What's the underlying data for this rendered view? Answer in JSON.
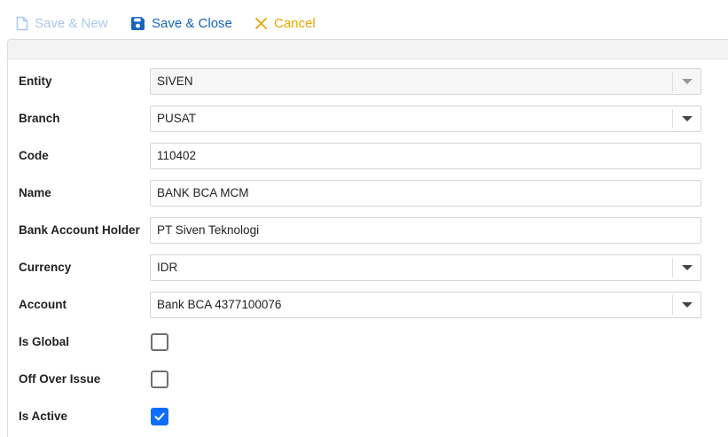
{
  "toolbar": {
    "save_new": {
      "label": "Save & New",
      "icon": "file-icon",
      "color": "#a9c8ec",
      "disabled": true
    },
    "save_close": {
      "label": "Save & Close",
      "icon": "floppy-disk-icon",
      "color": "#1565c0"
    },
    "cancel": {
      "label": "Cancel",
      "icon": "close-icon",
      "color": "#e8a700"
    }
  },
  "form": {
    "entity": {
      "label": "Entity",
      "value": "SIVEN",
      "disabled": true
    },
    "branch": {
      "label": "Branch",
      "value": "PUSAT"
    },
    "code": {
      "label": "Code",
      "value": "110402"
    },
    "name": {
      "label": "Name",
      "value": "BANK BCA MCM"
    },
    "holder": {
      "label": "Bank Account Holder",
      "value": "PT Siven Teknologi"
    },
    "currency": {
      "label": "Currency",
      "value": "IDR"
    },
    "account": {
      "label": "Account",
      "value": "Bank BCA 4377100076"
    },
    "is_global": {
      "label": "Is Global",
      "checked": false
    },
    "off_over_issue": {
      "label": "Off Over Issue",
      "checked": false
    },
    "is_active": {
      "label": "Is Active",
      "checked": true
    }
  },
  "colors": {
    "checkbox_checked": "#0d6efd",
    "label_text": "#222222",
    "field_border": "#d6d6d6"
  }
}
